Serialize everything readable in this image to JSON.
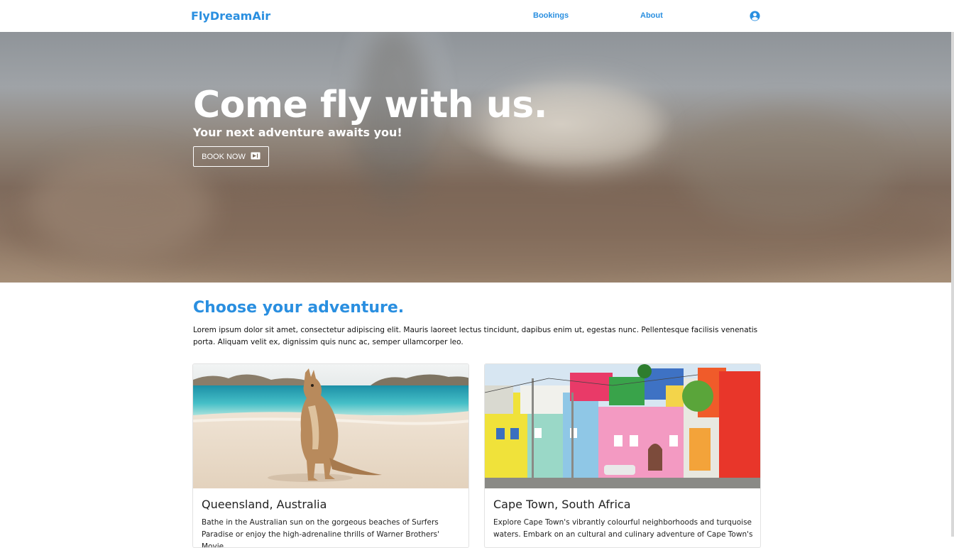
{
  "navbar": {
    "brand": "FlyDreamAir",
    "links": [
      "Bookings",
      "About"
    ],
    "account_icon": "user-circle-icon"
  },
  "hero": {
    "title": "Come fly with us.",
    "subtitle": "Your next adventure awaits you!",
    "button_label": "BOOK NOW",
    "button_icon": "ticket-icon"
  },
  "adventures": {
    "title": "Choose your adventure.",
    "intro": "Lorem ipsum dolor sit amet, consectetur adipiscing elit. Mauris laoreet lectus tincidunt, dapibus enim ut, egestas nunc. Pellentesque facilisis venenatis porta. Aliquam velit ex, dignissim quis nunc ac, semper ullamcorper leo.",
    "cards": [
      {
        "title": "Queensland, Australia",
        "text": "Bathe in the Australian sun on the gorgeous beaches of Surfers Paradise or enjoy the high-adrenaline thrills of Warner Brothers' Movie"
      },
      {
        "title": "Cape Town, South Africa",
        "text": "Explore Cape Town's vibrantly colourful neighborhoods and turquoise waters. Embark on an cultural and culinary adventure of Cape Town's"
      }
    ]
  },
  "colors": {
    "accent": "#2a8fe0"
  }
}
